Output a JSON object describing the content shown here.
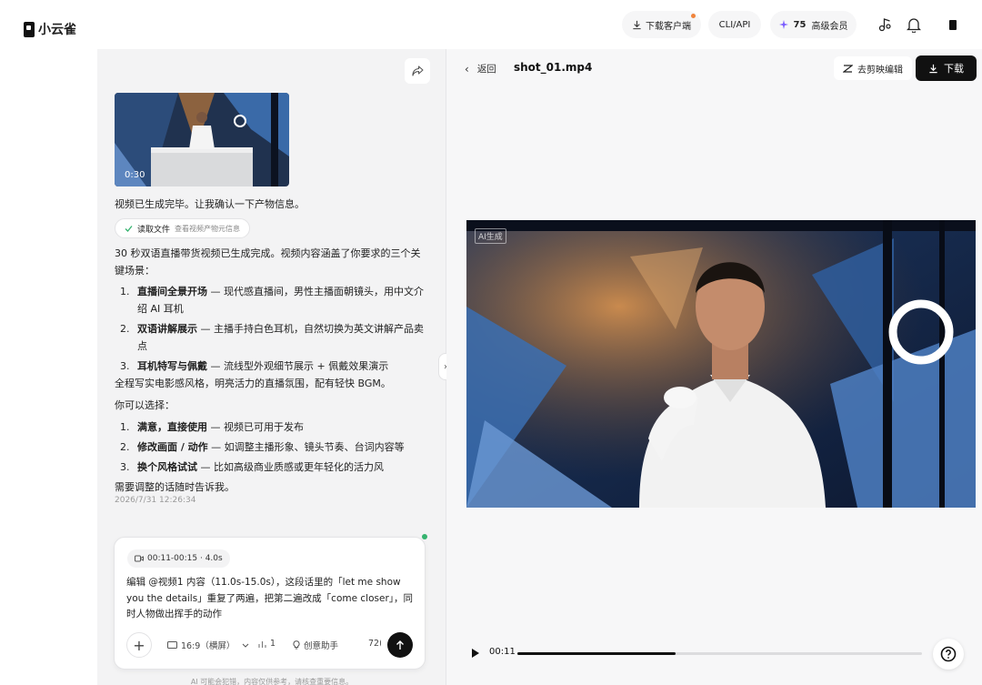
{
  "app": {
    "logo_text": "小云雀"
  },
  "topbar": {
    "download_client": "下载客户端",
    "cli_api": "CLI/API",
    "credits": "75",
    "membership": "高级会员"
  },
  "chat": {
    "thumbnail_duration": "0:30",
    "intro": "视频已生成完毕。让我确认一下产物信息。",
    "read_file_chip": {
      "label": "读取文件",
      "sub": "查看视频产物元信息"
    },
    "summary": "30 秒双语直播带货视频已生成完成。视频内容涵盖了你要求的三个关键场景：",
    "scenes": [
      {
        "num": "1.",
        "title": "直播间全景开场",
        "text": " — 现代感直播间，男性主播面朝镜头，用中文介绍 AI 耳机"
      },
      {
        "num": "2.",
        "title": "双语讲解展示",
        "text": " — 主播手持白色耳机，自然切换为英文讲解产品卖点"
      },
      {
        "num": "3.",
        "title": "耳机特写与佩戴",
        "text": " — 流线型外观细节展示 + 佩戴效果演示"
      }
    ],
    "style_note": "全程写实电影感风格，明亮活力的直播氛围，配有轻快 BGM。",
    "choices_intro": "你可以选择：",
    "choices": [
      {
        "num": "1.",
        "title": "满意，直接使用",
        "text": " — 视频已可用于发布"
      },
      {
        "num": "2.",
        "title": "修改画面 / 动作",
        "text": " — 如调整主播形象、镜头节奏、台词内容等"
      },
      {
        "num": "3.",
        "title": "换个风格试试",
        "text": " — 比如高级商业质感或更年轻化的活力风"
      }
    ],
    "outro": "需要调整的话随时告诉我。",
    "timestamp": "2026/7/31 12:26:34"
  },
  "composer": {
    "range_chip": "00:11-00:15 · 4.0s",
    "text": "编辑 @视频1 内容（11.0s-15.0s），这段话里的「let me show you the details」重复了两遍，把第二遍改成「come closer」，同时人物做出挥手的动作",
    "aspect": "16:9（横屏）",
    "count": "1",
    "assistant": "创意助手",
    "resolution": "72("
  },
  "disclaimer": "AI 可能会犯错，内容仅供参考，请核查重要信息。",
  "player": {
    "back": "返回",
    "filename": "shot_01.mp4",
    "edit_in_jianying": "去剪映编辑",
    "download": "下载",
    "watermark": "AI生成",
    "current_time": "00:11",
    "end_time_partial": "0(",
    "progress_fraction": 0.39
  }
}
